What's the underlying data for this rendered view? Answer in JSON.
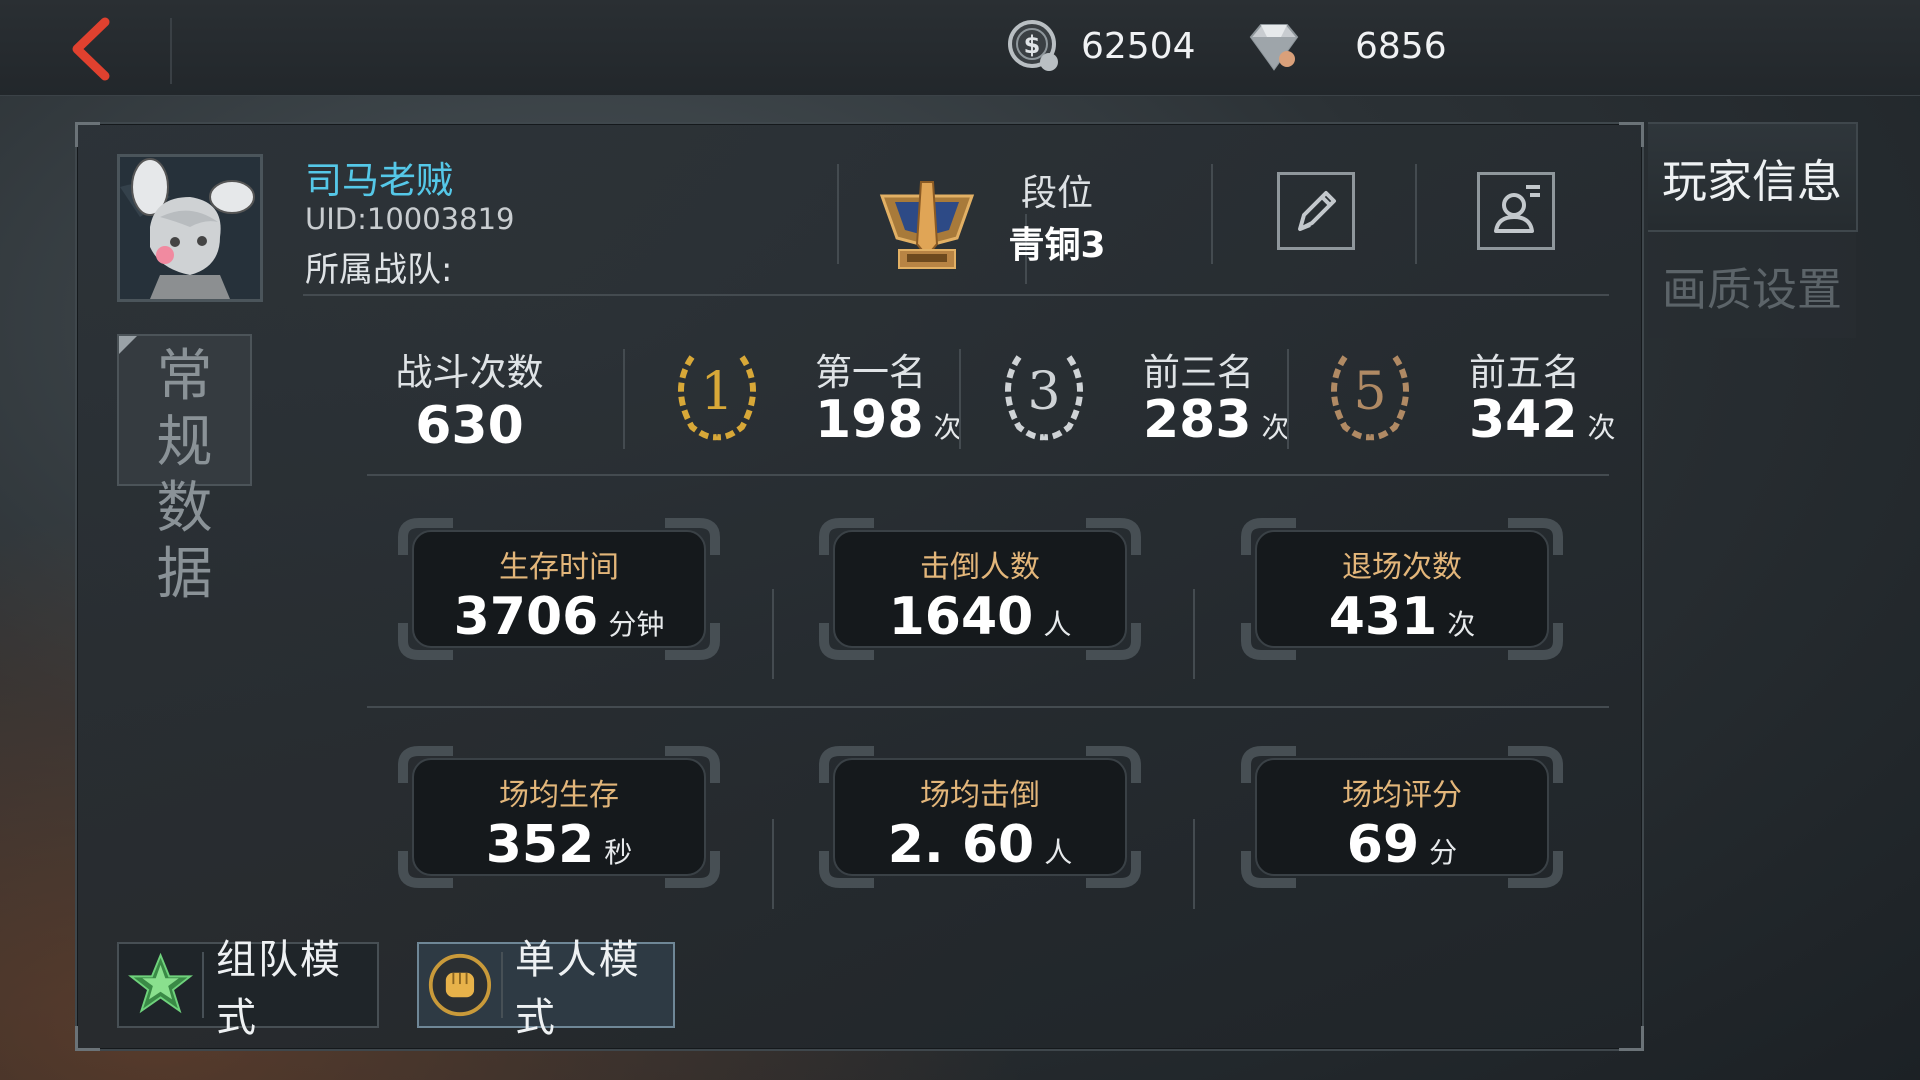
{
  "topbar": {
    "coins": "62504",
    "gems": "6856",
    "icons": {
      "back": "back-arrow-icon",
      "coin": "coin-icon",
      "gem": "gem-icon"
    }
  },
  "player": {
    "name": "司马老贼",
    "uid": "UID:10003819",
    "team_label": "所属战队:"
  },
  "rank": {
    "label": "段位",
    "value": "青铜3"
  },
  "side_tabs": {
    "player_info": "玩家信息",
    "quality_settings": "画质设置"
  },
  "category_tab": "常规数据",
  "summary": {
    "battles_label": "战斗次数",
    "battles_value": "630",
    "places": [
      {
        "badge": "1",
        "label": "第一名",
        "value": "198",
        "unit": "次"
      },
      {
        "badge": "3",
        "label": "前三名",
        "value": "283",
        "unit": "次"
      },
      {
        "badge": "5",
        "label": "前五名",
        "value": "342",
        "unit": "次"
      }
    ]
  },
  "stats": [
    {
      "label": "生存时间",
      "value": "3706",
      "unit": "分钟"
    },
    {
      "label": "击倒人数",
      "value": "1640",
      "unit": "人"
    },
    {
      "label": "退场次数",
      "value": "431",
      "unit": "次"
    },
    {
      "label": "场均生存",
      "value": "352",
      "unit": "秒"
    },
    {
      "label": "场均击倒",
      "value": "2. 60",
      "unit": "人"
    },
    {
      "label": "场均评分",
      "value": "69",
      "unit": "分"
    }
  ],
  "modes": {
    "team": "组队模式",
    "solo": "单人模式"
  },
  "colors": {
    "name": "#55c8e8",
    "stat_label": "#e3b67a",
    "back_arrow": "#e0412f",
    "gold": "#d8a838",
    "silver": "#cfd3d6",
    "bronze": "#b08a64"
  }
}
